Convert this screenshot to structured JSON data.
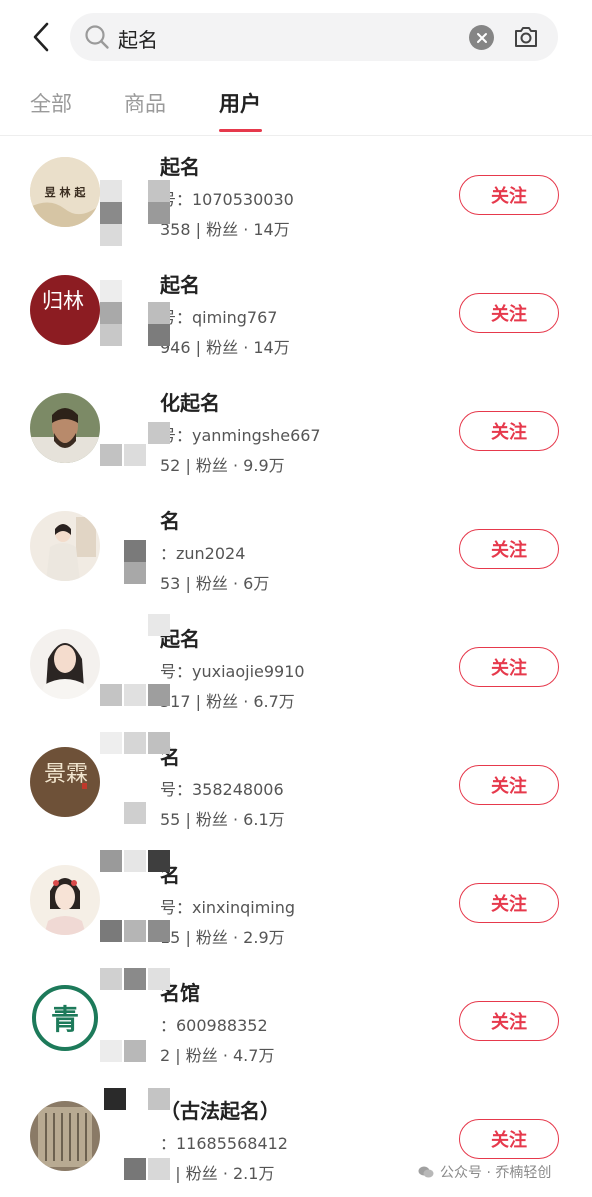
{
  "search": {
    "query": "起名"
  },
  "tabs": [
    {
      "label": "全部"
    },
    {
      "label": "商品"
    },
    {
      "label": "用户"
    }
  ],
  "users": [
    {
      "name": "起名",
      "account": "号：1070530030",
      "stats": "358 | 粉丝 · 14万",
      "follow": "关注",
      "avatar_text": "昱 林 起"
    },
    {
      "name": "起名",
      "account": "号：qiming767",
      "stats": "946 | 粉丝 · 14万",
      "follow": "关注",
      "avatar_text": "归林"
    },
    {
      "name": "化起名",
      "account": "号：yanmingshe667",
      "stats": "52 | 粉丝 · 9.9万",
      "follow": "关注"
    },
    {
      "name": "名",
      "account": "：zun2024",
      "stats": "53 | 粉丝 · 6万",
      "follow": "关注"
    },
    {
      "name": "起名",
      "account": "号：yuxiaojie9910",
      "stats": "517 | 粉丝 · 6.7万",
      "follow": "关注"
    },
    {
      "name": "名",
      "account": "号：358248006",
      "stats": "55 | 粉丝 · 6.1万",
      "follow": "关注",
      "avatar_text": "景霖"
    },
    {
      "name": "名",
      "account": "号：xinxinqiming",
      "stats": "15 | 粉丝 · 2.9万",
      "follow": "关注"
    },
    {
      "name": "名馆",
      "account": "：600988352",
      "stats": "2 | 粉丝 · 4.7万",
      "follow": "关注",
      "avatar_text": "青"
    },
    {
      "name": "（古法起名）",
      "account": "：11685568412",
      "stats": "7 | 粉丝 · 2.1万",
      "follow": "关注"
    }
  ],
  "watermark": {
    "text": "公众号 · 乔楠轻创"
  }
}
